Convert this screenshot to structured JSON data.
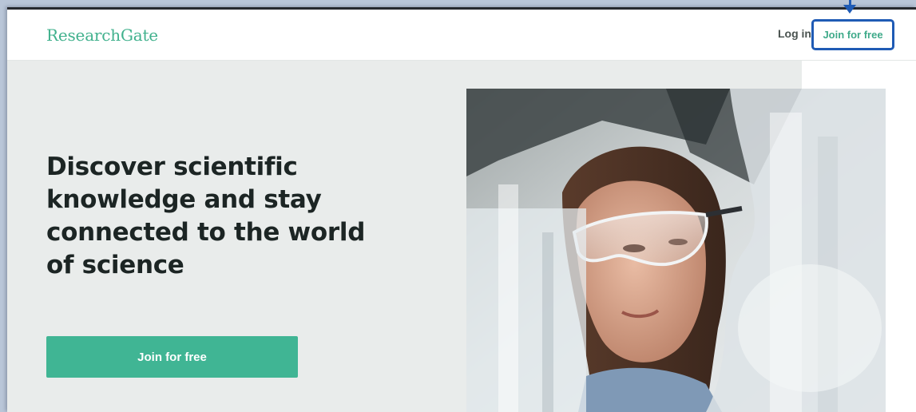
{
  "header": {
    "logo": "ResearchGate",
    "login_label": "Log in",
    "join_label": "Join for free"
  },
  "hero": {
    "headline": "Discover scientific knowledge and stay connected to the world of science",
    "cta_label": "Join for free",
    "image_alt": "Scientist wearing safety goggles in a laboratory"
  },
  "colors": {
    "brand": "#40b594",
    "highlight": "#1f5bb5",
    "hero_bg": "#e9eceb"
  }
}
